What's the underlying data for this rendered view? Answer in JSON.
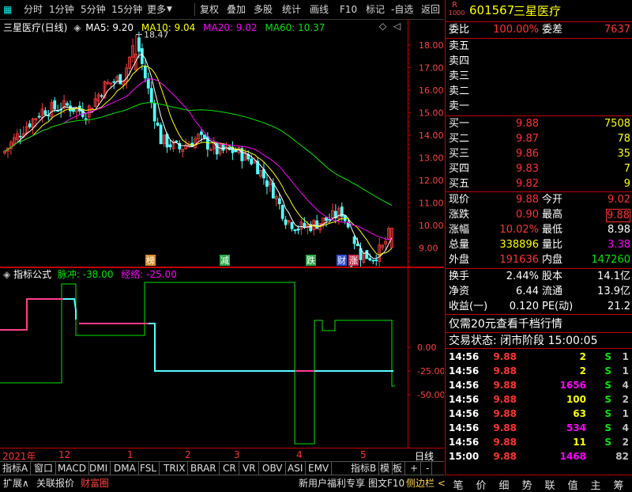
{
  "toolbar": {
    "items": [
      "分时",
      "1分钟",
      "5分钟",
      "15分钟",
      "更多",
      "复权",
      "叠加",
      "多股",
      "统计",
      "画线",
      "F10",
      "标记",
      "-自选",
      "返回"
    ]
  },
  "chart": {
    "title": "三星医疗(日线)",
    "ma5": "MA5: 9.20",
    "ma10": "MA10: 9.04",
    "ma20": "MA20: 9.02",
    "ma60": "MA60: 10.37",
    "high_mark": "18.47",
    "low_mark": "7.78",
    "y_ticks": [
      "18.00",
      "17.00",
      "16.00",
      "15.00",
      "14.00",
      "13.00",
      "12.00",
      "11.00",
      "10.00",
      "9.00",
      "8.00"
    ],
    "events": [
      "榜",
      "减",
      "跌",
      "财",
      "涨"
    ],
    "colors": {
      "up": "#ff3c3c",
      "down": "#54ffff",
      "ma5": "#ffffff",
      "ma10": "#ffff00",
      "ma20": "#ff00ff",
      "ma60": "#00e600"
    }
  },
  "indicator": {
    "title": "指标公式",
    "line1": "脉冲: -38.00",
    "line2": "经络: -25.00",
    "y_ticks": [
      "0.00",
      "-25.00",
      "-50.00"
    ]
  },
  "x_axis": {
    "labels": [
      "2021年",
      "12",
      "1",
      "2",
      "3",
      "4",
      "5"
    ],
    "period": "日线"
  },
  "bottom_tabs": [
    "指标A",
    "窗口",
    "MACD",
    "DMI",
    "DMA",
    "FSL",
    "TRIX",
    "BRAR",
    "CR",
    "VR",
    "OBV",
    "ASI",
    "EMV",
    "指标B",
    "模",
    "板",
    "+",
    "-"
  ],
  "status_bar": {
    "left": [
      "扩展∧",
      "关联报价",
      "财富圈"
    ],
    "right": [
      "新用户福利专享",
      "图文F10",
      "侧边栏 <"
    ]
  },
  "quote": {
    "logo": "R",
    "logo_sub": "1000",
    "code": "601567",
    "name": "三星医疗",
    "weibi_label": "委比",
    "weibi": "100.00%",
    "weicha_label": "委差",
    "weicha": "7637",
    "asks": [
      {
        "label": "卖五",
        "price": "",
        "vol": ""
      },
      {
        "label": "卖四",
        "price": "",
        "vol": ""
      },
      {
        "label": "卖三",
        "price": "",
        "vol": ""
      },
      {
        "label": "卖二",
        "price": "",
        "vol": ""
      },
      {
        "label": "卖一",
        "price": "",
        "vol": ""
      }
    ],
    "bids": [
      {
        "label": "买一",
        "price": "9.88",
        "vol": "7508"
      },
      {
        "label": "买二",
        "price": "9.87",
        "vol": "78"
      },
      {
        "label": "买三",
        "price": "9.86",
        "vol": "35"
      },
      {
        "label": "买四",
        "price": "9.83",
        "vol": "7"
      },
      {
        "label": "买五",
        "price": "9.82",
        "vol": "9"
      }
    ],
    "stats": [
      {
        "l1": "现价",
        "v1": "9.88",
        "l2": "今开",
        "v2": "9.02"
      },
      {
        "l1": "涨跌",
        "v1": "0.90",
        "l2": "最高",
        "v2": "9.88"
      },
      {
        "l1": "涨幅",
        "v1": "10.02%",
        "l2": "最低",
        "v2": "8.98"
      },
      {
        "l1": "总量",
        "v1": "338896",
        "l2": "量比",
        "v2": "3.38"
      },
      {
        "l1": "外盘",
        "v1": "191636",
        "l2": "内盘",
        "v2": "147260"
      }
    ],
    "stats2": [
      {
        "l1": "换手",
        "v1": "2.44%",
        "l2": "股本",
        "v2": "14.1亿"
      },
      {
        "l1": "净资",
        "v1": "6.44",
        "l2": "流通",
        "v2": "13.9亿"
      },
      {
        "l1": "收益(一)",
        "v1": "0.120",
        "l2": "PE(动)",
        "v2": "21.2"
      }
    ],
    "promo": "仅需20元查看千档行情",
    "trade_status": "交易状态: 闭市阶段 15:00:05",
    "ticks": [
      {
        "t": "14:56",
        "p": "9.88",
        "v": "2",
        "d": "S",
        "n": "1"
      },
      {
        "t": "14:56",
        "p": "9.88",
        "v": "2",
        "d": "S",
        "n": "1"
      },
      {
        "t": "14:56",
        "p": "9.88",
        "v": "1656",
        "d": "S",
        "n": "4"
      },
      {
        "t": "14:56",
        "p": "9.88",
        "v": "100",
        "d": "S",
        "n": "2"
      },
      {
        "t": "14:56",
        "p": "9.88",
        "v": "63",
        "d": "S",
        "n": "1"
      },
      {
        "t": "14:56",
        "p": "9.88",
        "v": "534",
        "d": "S",
        "n": "4"
      },
      {
        "t": "14:56",
        "p": "9.88",
        "v": "11",
        "d": "S",
        "n": "2"
      },
      {
        "t": "15:00",
        "p": "9.88",
        "v": "1468",
        "d": "",
        "n": "82"
      }
    ],
    "bottom_buttons": [
      "笔",
      "价",
      "细",
      "势",
      "联",
      "值",
      "主",
      "筹"
    ]
  }
}
